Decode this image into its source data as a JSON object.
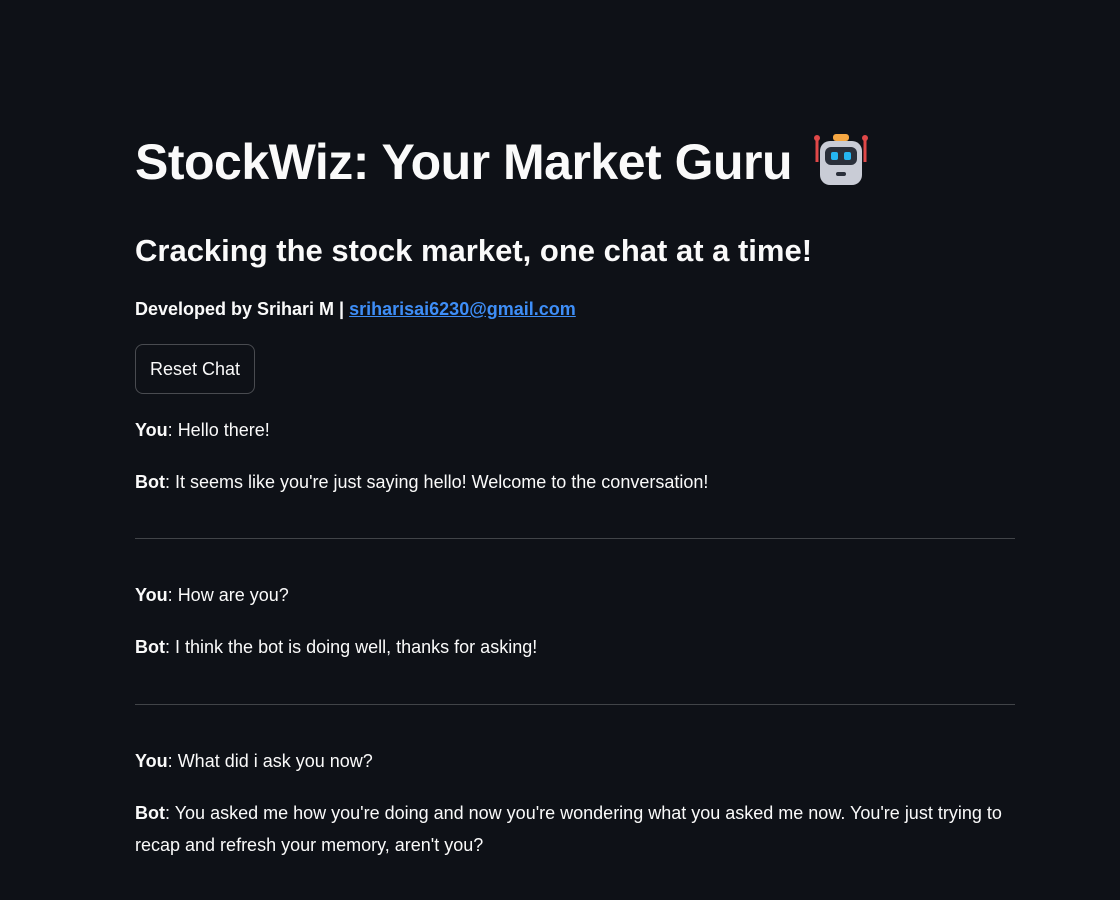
{
  "header": {
    "title": "StockWiz: Your Market Guru",
    "title_icon": "robot-icon",
    "subtitle": "Cracking the stock market, one chat at a time!",
    "developer_prefix": "Developed by Srihari M |",
    "developer_email": "sriharisai6230@gmail.com"
  },
  "controls": {
    "reset_label": "Reset Chat"
  },
  "chat": {
    "you_label": "You",
    "bot_label": "Bot",
    "turns": [
      {
        "user": "Hello there!",
        "bot": "It seems like you're just saying hello! Welcome to the conversation!"
      },
      {
        "user": "How are you?",
        "bot": "I think the bot is doing well, thanks for asking!"
      },
      {
        "user": "What did i ask you now?",
        "bot": "You asked me how you're doing and now you're wondering what you asked me now. You're just trying to recap and refresh your memory, aren't you?"
      }
    ]
  },
  "colors": {
    "background": "#0e1117",
    "text": "#fafafa",
    "link": "#3e8ef7"
  }
}
